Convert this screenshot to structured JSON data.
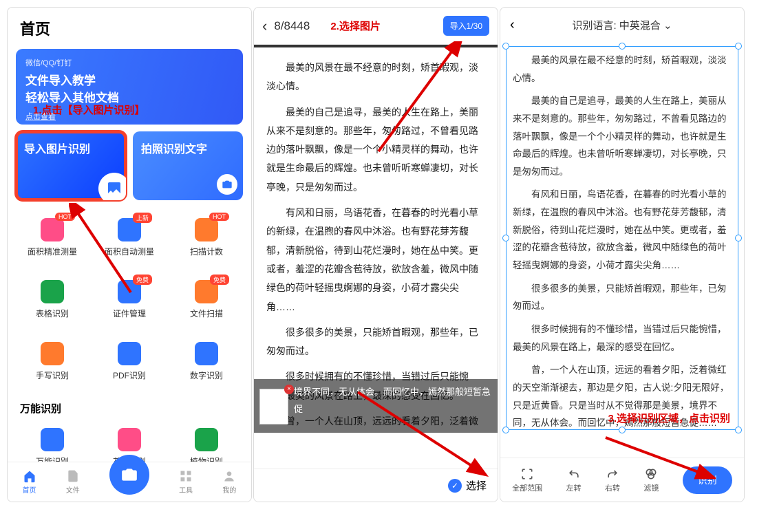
{
  "screen1": {
    "title": "首页",
    "banner": {
      "line0": "微信/QQ/钉钉",
      "line1": "文件导入教学",
      "line2": "轻松导入其他文档",
      "line3": "点击查看"
    },
    "annotation1": "1.点击【导入图片识别】",
    "card_import": "导入图片识别",
    "card_photo": "拍照识别文字",
    "grid": [
      {
        "label": "面积精准测量",
        "badge": "HOT",
        "iconClass": "pink"
      },
      {
        "label": "面积自动测量",
        "badge": "上新",
        "iconClass": "blue"
      },
      {
        "label": "扫描计数",
        "badge": "HOT",
        "iconClass": "orange"
      },
      {
        "label": "表格识别",
        "badge": "",
        "iconClass": "green"
      },
      {
        "label": "证件管理",
        "badge": "免费",
        "iconClass": "blue2"
      },
      {
        "label": "文件扫描",
        "badge": "免费",
        "iconClass": "orange2"
      },
      {
        "label": "手写识别",
        "badge": "",
        "iconClass": "orange"
      },
      {
        "label": "PDF识别",
        "badge": "",
        "iconClass": "blue"
      },
      {
        "label": "数字识别",
        "badge": "",
        "iconClass": "blue2"
      }
    ],
    "section2_title": "万能识别",
    "row2": [
      {
        "label": "万能识别"
      },
      {
        "label": "花草识别"
      },
      {
        "label": "植物识别"
      }
    ],
    "nav": {
      "home": "首页",
      "files": "文件",
      "tools": "工具",
      "mine": "我的"
    }
  },
  "screen2": {
    "counter": "8/8448",
    "annotation": "2.选择图片",
    "import_btn": "导入1/30",
    "paragraphs": [
      "最美的风景在最不经意的时刻，矫首暇观，淡淡心情。",
      "最美的自己是追寻，最美的人生在路上，美丽从来不是刻意的。那些年，匆匆路过，不曾看见路边的落叶飘飘，像是一个个小精灵样的舞动，也许就是生命最后的辉煌。也未曾听听寒蝉凄切，对长亭晚，只是匆匆而过。",
      "有风和日丽，鸟语花香，在暮春的时光看小草的新绿，在温煦的春风中沐浴。也有野花芽芳馥郁，清新脱俗，待到山花烂漫时，她在丛中笑。更或者，羞涩的花瓣含苞待放，欲放含羞，微风中随绿色的荷叶轻摇曳婀娜的身姿，小荷才露尖尖角……",
      "很多很多的美景，只能矫首暇观，那些年，已匆匆而过。",
      "很多时候拥有的不懂珍惜，当错过后只能惋惜，最美的风景在路上，最深的感受在回忆。",
      "曾，一个人在山顶，远远的看着夕阳，泛着微红的天空渐渐褪去，那边是夕阳，古人说:夕阳无限好，只是近黄昏。只是当时从不觉得那是美景，"
    ],
    "dim_tail": "境界不同，无从体会。而回忆中，嫣然那般短暂急促",
    "select_label": "选择"
  },
  "screen3": {
    "lang_prefix": "识别语言: ",
    "lang_value": "中英混合",
    "paragraphs": [
      "最美的风景在最不经意的时刻，矫首暇观，淡淡心情。",
      "最美的自己是追寻，最美的人生在路上，美丽从来不是刻意的。那些年，匆匆路过，不曾看见路边的落叶飘飘，像是一个个小精灵样的舞动，也许就是生命最后的辉煌。也未曾听听寒蝉凄切，对长亭晚，只是匆匆而过。",
      "有风和日丽，鸟语花香，在暮春的时光看小草的新绿，在温煦的春风中沐浴。也有野花芽芳馥郁，清新脱俗，待到山花烂漫时，她在丛中笑。更或者，羞涩的花瓣含苞待放，欲放含羞，微风中随绿色的荷叶轻摇曳婀娜的身姿，小荷才露尖尖角……",
      "很多很多的美景，只能矫首暇观，那些年，已匆匆而过。",
      "很多时候拥有的不懂珍惜，当错过后只能惋惜，最美的风景在路上，最深的感受在回忆。",
      "曾，一个人在山顶，远远的看着夕阳，泛着微红的天空渐渐褪去，那边是夕阳，古人说:夕阳无限好，只是近黄昏。只是当时从不觉得那是美景，境界不同，无从体会。而回忆中，嫣然那般短暂急促……"
    ],
    "annotation": "3.选择识别区域，点击识别",
    "toolbar": {
      "full": "全部范围",
      "left": "左转",
      "right": "右转",
      "filter": "滤镜",
      "recognize": "识别"
    }
  }
}
